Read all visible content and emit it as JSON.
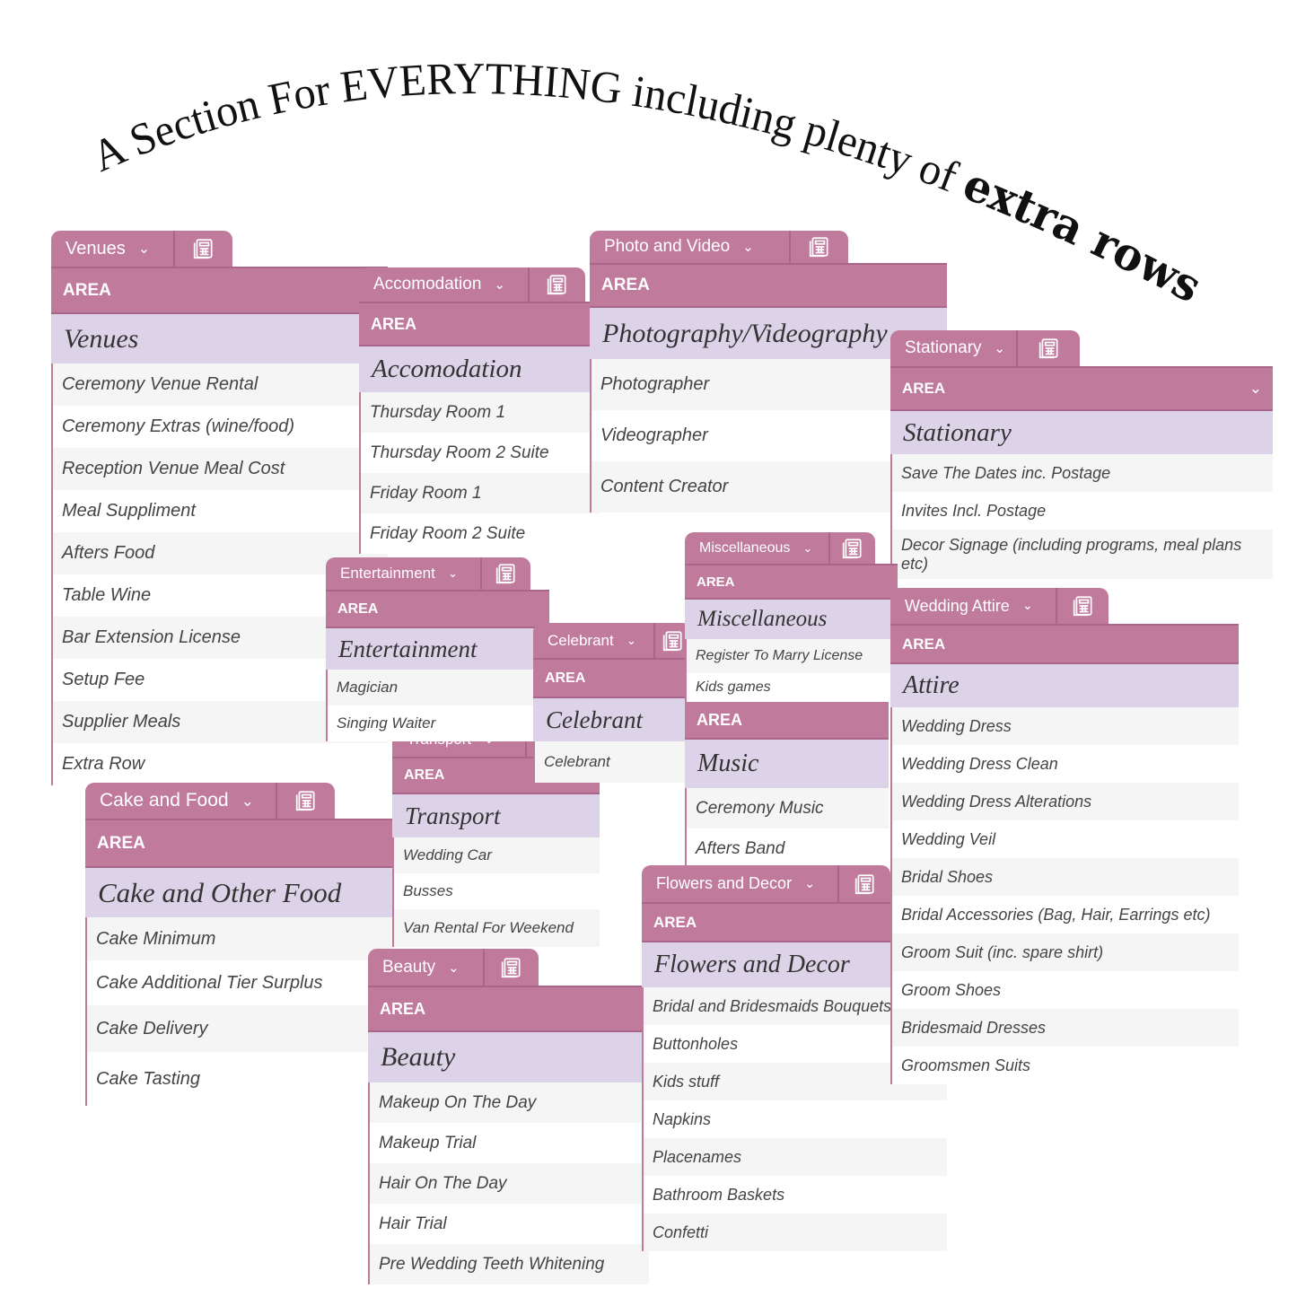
{
  "headline": {
    "regular": "A Section For EVERYTHING including plenty of ",
    "bold": "extra rows!"
  },
  "colors": {
    "accent": "#c07a9c",
    "title_row": "#dcd3e8",
    "row": "#f5f5f5",
    "text": "#444444"
  },
  "icons": {
    "tab_dropdown": "chevron-down-icon",
    "tab_sheet": "calculator-icon"
  },
  "cards": [
    {
      "tab_label": "Venues",
      "area_label": "AREA",
      "title": "Venues",
      "rows": [
        "Ceremony Venue Rental",
        "Ceremony Extras (wine/food)",
        "Reception Venue Meal Cost",
        "Meal Suppliment",
        "Afters Food",
        "Table Wine",
        "Bar Extension License",
        "Setup Fee",
        "Supplier Meals",
        "Extra Row"
      ]
    },
    {
      "tab_label": "Accomodation",
      "area_label": "AREA",
      "title": "Accomodation",
      "rows": [
        "Thursday Room 1",
        "Thursday Room 2 Suite",
        "Friday Room 1",
        "Friday Room 2 Suite"
      ]
    },
    {
      "tab_label": "Photo and Video",
      "area_label": "AREA",
      "title": "Photography/Videography",
      "rows": [
        "Photographer",
        "Videographer",
        "Content Creator"
      ]
    },
    {
      "tab_label": "Stationary",
      "area_label": "AREA",
      "title": "Stationary",
      "rows": [
        "Save The Dates inc. Postage",
        "Invites Incl. Postage",
        "Decor Signage (including programs, meal plans etc)"
      ]
    },
    {
      "tab_label": "Transport",
      "area_label": "AREA",
      "title": "Transport",
      "rows": [
        "Wedding Car",
        "Busses",
        "Van Rental For Weekend"
      ]
    },
    {
      "tab_label": "Entertainment",
      "area_label": "AREA",
      "title": "Entertainment",
      "rows": [
        "Magician",
        "Singing Waiter"
      ]
    },
    {
      "tab_label": "Celebrant",
      "area_label": "AREA",
      "title": "Celebrant",
      "rows": [
        "Celebrant"
      ]
    },
    {
      "area_label": "AREA",
      "title": "Music",
      "rows": [
        "Ceremony Music",
        "Afters Band"
      ]
    },
    {
      "tab_label": "Miscellaneous",
      "area_label": "AREA",
      "title": "Miscellaneous",
      "rows": [
        "Register To Marry License",
        "Kids games"
      ]
    },
    {
      "tab_label": "Cake and Food",
      "area_label": "AREA",
      "title": "Cake and Other Food",
      "rows": [
        "Cake Minimum",
        "Cake Additional Tier Surplus",
        "Cake Delivery",
        "Cake Tasting"
      ]
    },
    {
      "tab_label": "Beauty",
      "area_label": "AREA",
      "title": "Beauty",
      "rows": [
        "Makeup On The Day",
        "Makeup Trial",
        "Hair On The Day",
        "Hair Trial",
        "Pre Wedding Teeth Whitening"
      ]
    },
    {
      "tab_label": "Flowers and Decor",
      "area_label": "AREA",
      "title": "Flowers and Decor",
      "rows": [
        "Bridal and Bridesmaids Bouquets",
        "Buttonholes",
        "Kids stuff",
        "Napkins",
        "Placenames",
        "Bathroom Baskets",
        "Confetti"
      ]
    },
    {
      "tab_label": "Wedding Attire",
      "area_label": "AREA",
      "title": "Attire",
      "rows": [
        "Wedding Dress",
        "Wedding Dress Clean",
        "Wedding Dress Alterations",
        "Wedding Veil",
        "Bridal Shoes",
        "Bridal Accessories (Bag, Hair, Earrings etc)",
        "Groom Suit (inc. spare shirt)",
        "Groom Shoes",
        "Bridesmaid Dresses",
        "Groomsmen Suits"
      ]
    }
  ]
}
